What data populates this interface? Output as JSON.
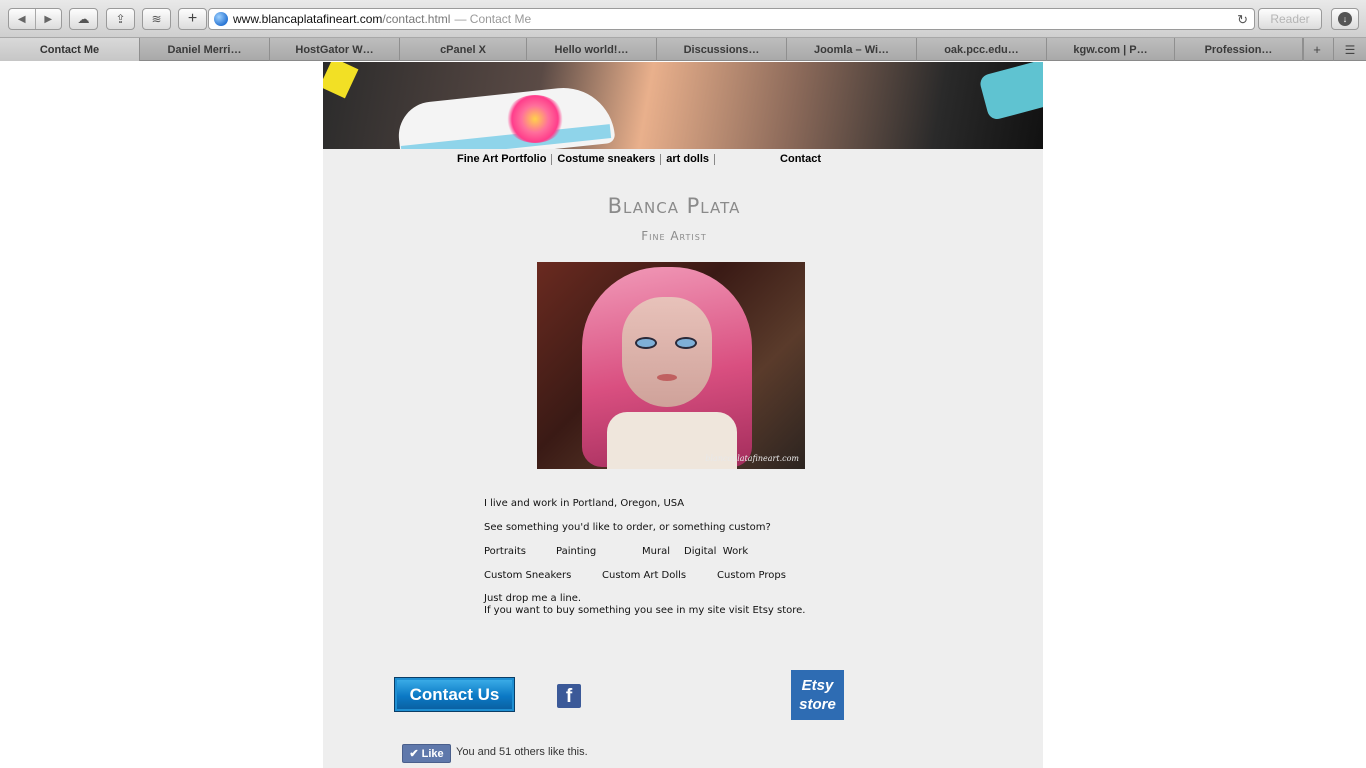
{
  "browser": {
    "url_host": "www.blancaplatafineart.com",
    "url_path": "/contact.html",
    "url_title": "— Contact Me",
    "reader_label": "Reader",
    "tabs": [
      {
        "label": "Contact Me",
        "active": true
      },
      {
        "label": "Daniel Merri…",
        "active": false
      },
      {
        "label": "HostGator W…",
        "active": false
      },
      {
        "label": "cPanel X",
        "active": false
      },
      {
        "label": "Hello world!…",
        "active": false
      },
      {
        "label": "Discussions…",
        "active": false
      },
      {
        "label": "Joomla – Wi…",
        "active": false
      },
      {
        "label": "oak.pcc.edu…",
        "active": false
      },
      {
        "label": "kgw.com | P…",
        "active": false
      },
      {
        "label": "Profession…",
        "active": false
      }
    ]
  },
  "nav": {
    "items": [
      "Fine Art Portfolio",
      "Costume sneakers",
      "art dolls",
      "Contact"
    ]
  },
  "header": {
    "name": "Blanca Plata",
    "title": "Fine Artist"
  },
  "image": {
    "watermark": "blancaplatafineart.com"
  },
  "content": {
    "line1": "I live and work in Portland, Oregon, USA",
    "line2": "See something you'd like to order, or something custom?",
    "services_row1": [
      "Portraits",
      "Painting",
      "Mural",
      "Digital  Work"
    ],
    "services_row2": [
      "Custom Sneakers",
      "Custom Art Dolls",
      "Custom Props"
    ],
    "drop_line": "Just drop me a line.",
    "buy_line": "If you want to buy something you see in my site visit Etsy store."
  },
  "actions": {
    "contact_us": "Contact Us",
    "facebook": "f",
    "etsy_line1": "Etsy",
    "etsy_line2": "store",
    "like_label": "Like",
    "like_text": "You and 51 others like this."
  }
}
